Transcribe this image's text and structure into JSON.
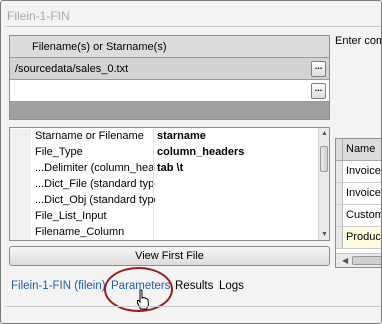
{
  "window": {
    "title": "Filein-1-FIN"
  },
  "side_text": "Enter com",
  "files": {
    "header": "Filename(s) or Starname(s)",
    "rows": [
      {
        "value": "/sourcedata/sales_0.txt",
        "button": "..."
      },
      {
        "value": "",
        "button": "..."
      }
    ]
  },
  "properties": [
    {
      "name": "Starname or Filename",
      "value": "starname"
    },
    {
      "name": "File_Type",
      "value": "column_headers"
    },
    {
      "name": "...Delimiter (column_heac",
      "value": "tab \\t"
    },
    {
      "name": "...Dict_File (standard type",
      "value": ""
    },
    {
      "name": "...Dict_Obj (standard type",
      "value": ""
    },
    {
      "name": "File_List_Input",
      "value": ""
    },
    {
      "name": "Filename_Column",
      "value": ""
    }
  ],
  "view_button": "View First File",
  "right_grid": {
    "header": "Name",
    "rows": [
      "Invoice N",
      "Invoice F",
      "Custome",
      "Product"
    ]
  },
  "tabs": [
    {
      "label": "Filein-1-FIN (filein)",
      "link": true
    },
    {
      "label": "Parameters",
      "link": true
    },
    {
      "label": "Results",
      "link": false
    },
    {
      "label": "Logs",
      "link": false
    }
  ],
  "colors": {
    "link": "#1f5fa8",
    "highlight": "#9b1c1c"
  }
}
